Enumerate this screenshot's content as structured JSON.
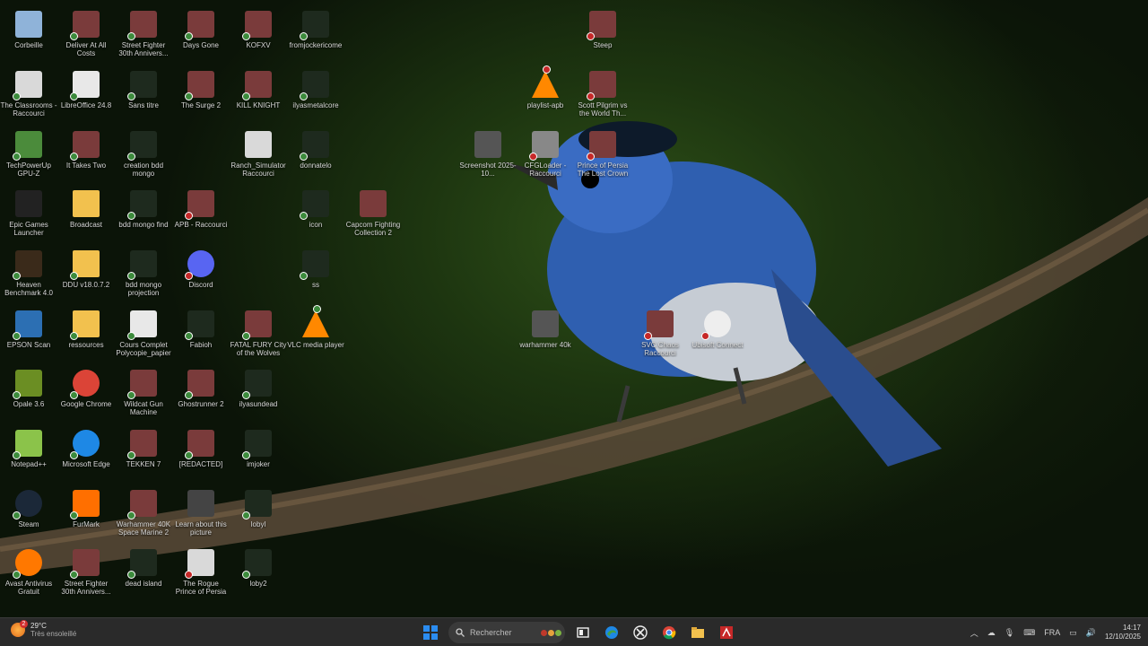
{
  "colors": {
    "taskbar": "#2a2a2a",
    "ok_badge": "#3c8b3c",
    "err_badge": "#c62828"
  },
  "desktop": {
    "icons": [
      {
        "label": "Corbeille",
        "icon": "recycle-bin-icon",
        "badge": "none"
      },
      {
        "label": "Deliver At All Costs",
        "icon": "game-icon",
        "badge": "ok"
      },
      {
        "label": "Street Fighter 30th Annivers...",
        "icon": "game-icon",
        "badge": "ok"
      },
      {
        "label": "Days Gone",
        "icon": "game-icon",
        "badge": "ok"
      },
      {
        "label": "KOFXV",
        "icon": "game-icon",
        "badge": "ok"
      },
      {
        "label": "fromjockericome",
        "icon": "video-icon",
        "badge": "ok"
      },
      {
        "label": "The Classrooms - Raccourci",
        "icon": "shortcut-icon",
        "badge": "ok"
      },
      {
        "label": "LibreOffice 24.8",
        "icon": "document-icon",
        "badge": "ok"
      },
      {
        "label": "Sans titre",
        "icon": "video-icon",
        "badge": "ok"
      },
      {
        "label": "The Surge 2",
        "icon": "game-icon",
        "badge": "ok"
      },
      {
        "label": "KILL KNIGHT",
        "icon": "game-icon",
        "badge": "ok"
      },
      {
        "label": "ilyasmetalcore",
        "icon": "video-icon",
        "badge": "ok"
      },
      {
        "label": "TechPowerUp GPU-Z",
        "icon": "gpu-icon",
        "badge": "ok"
      },
      {
        "label": "It Takes Two",
        "icon": "game-icon",
        "badge": "ok"
      },
      {
        "label": "creation bdd mongo",
        "icon": "video-icon",
        "badge": "ok"
      },
      {
        "label": "Ranch_Simulator Raccourci",
        "icon": "shortcut-icon",
        "badge": "none"
      },
      {
        "label": "donnatelo",
        "icon": "video-icon",
        "badge": "ok"
      },
      {
        "label": "Epic Games Launcher",
        "icon": "epic-games-icon",
        "badge": "none"
      },
      {
        "label": "Broadcast",
        "icon": "folder-icon",
        "badge": "none"
      },
      {
        "label": "bdd mongo find",
        "icon": "video-icon",
        "badge": "ok"
      },
      {
        "label": "APB - Raccourci",
        "icon": "game-icon",
        "badge": "err"
      },
      {
        "label": "icon",
        "icon": "video-icon",
        "badge": "ok"
      },
      {
        "label": "Capcom Fighting Collection 2",
        "icon": "game-icon",
        "badge": "none"
      },
      {
        "label": "Heaven Benchmark 4.0",
        "icon": "benchmark-icon",
        "badge": "ok"
      },
      {
        "label": "DDU v18.0.7.2",
        "icon": "folder-icon",
        "badge": "ok"
      },
      {
        "label": "bdd mongo projection",
        "icon": "video-icon",
        "badge": "ok"
      },
      {
        "label": "Discord",
        "icon": "discord-icon",
        "badge": "err"
      },
      {
        "label": "ss",
        "icon": "video-icon",
        "badge": "ok"
      },
      {
        "label": "EPSON Scan",
        "icon": "scanner-icon",
        "badge": "ok"
      },
      {
        "label": "ressources",
        "icon": "folder-icon",
        "badge": "ok"
      },
      {
        "label": "Cours Complet Polycopie_papier",
        "icon": "document-icon",
        "badge": "ok"
      },
      {
        "label": "Fabioh",
        "icon": "video-icon",
        "badge": "ok"
      },
      {
        "label": "FATAL FURY City of the Wolves",
        "icon": "game-icon",
        "badge": "ok"
      },
      {
        "label": "VLC media player",
        "icon": "vlc-icon",
        "badge": "ok"
      },
      {
        "label": "Opale 3.6",
        "icon": "app-icon",
        "badge": "ok"
      },
      {
        "label": "Google Chrome",
        "icon": "chrome-icon",
        "badge": "ok"
      },
      {
        "label": "Wildcat Gun Machine",
        "icon": "game-icon",
        "badge": "ok"
      },
      {
        "label": "Ghostrunner 2",
        "icon": "game-icon",
        "badge": "ok"
      },
      {
        "label": "ilyasundead",
        "icon": "video-icon",
        "badge": "ok"
      },
      {
        "label": "Notepad++",
        "icon": "notepad-icon",
        "badge": "ok"
      },
      {
        "label": "Microsoft Edge",
        "icon": "edge-icon",
        "badge": "ok"
      },
      {
        "label": "TEKKEN 7",
        "icon": "game-icon",
        "badge": "ok"
      },
      {
        "label": "[REDACTED]",
        "icon": "game-icon",
        "badge": "ok"
      },
      {
        "label": "imjoker",
        "icon": "video-icon",
        "badge": "ok"
      },
      {
        "label": "Steam",
        "icon": "steam-icon",
        "badge": "ok"
      },
      {
        "label": "FurMark",
        "icon": "furmark-icon",
        "badge": "ok"
      },
      {
        "label": "Warhammer 40K Space Marine 2",
        "icon": "game-icon",
        "badge": "ok"
      },
      {
        "label": "Learn about this picture",
        "icon": "camera-icon",
        "badge": "none"
      },
      {
        "label": "lobyl",
        "icon": "video-icon",
        "badge": "ok"
      },
      {
        "label": "Avast Antivirus Gratuit",
        "icon": "avast-icon",
        "badge": "ok"
      },
      {
        "label": "Street Fighter 30th Annivers...",
        "icon": "game-icon",
        "badge": "ok"
      },
      {
        "label": "dead island",
        "icon": "video-icon",
        "badge": "ok"
      },
      {
        "label": "The Rogue Prince of Persia",
        "icon": "shortcut-icon",
        "badge": "err"
      },
      {
        "label": "loby2",
        "icon": "video-icon",
        "badge": "ok"
      },
      {
        "label": "Steep",
        "icon": "game-icon",
        "badge": "err"
      },
      {
        "label": "playlist-apb",
        "icon": "vlc-icon",
        "badge": "err"
      },
      {
        "label": "Scott Pilgrim vs the World Th...",
        "icon": "game-icon",
        "badge": "err"
      },
      {
        "label": "Screenshot 2025-10...",
        "icon": "image-icon",
        "badge": "none"
      },
      {
        "label": "CFGLoader - Raccourci",
        "icon": "settings-icon",
        "badge": "err"
      },
      {
        "label": "Prince of Persia The Lost Crown",
        "icon": "game-icon",
        "badge": "err"
      },
      {
        "label": "warhammer 40k",
        "icon": "image-icon",
        "badge": "none"
      },
      {
        "label": "SVC Chaos Raccourci",
        "icon": "game-icon",
        "badge": "err"
      },
      {
        "label": "Ubisoft Connect",
        "icon": "ubisoft-icon",
        "badge": "err"
      }
    ]
  },
  "taskbar": {
    "weather": {
      "temp": "29°C",
      "desc": "Très ensoleillé",
      "alert": "2"
    },
    "search_placeholder": "Rechercher",
    "language": "FRA",
    "time": "14:17",
    "date": "12/10/2025"
  }
}
